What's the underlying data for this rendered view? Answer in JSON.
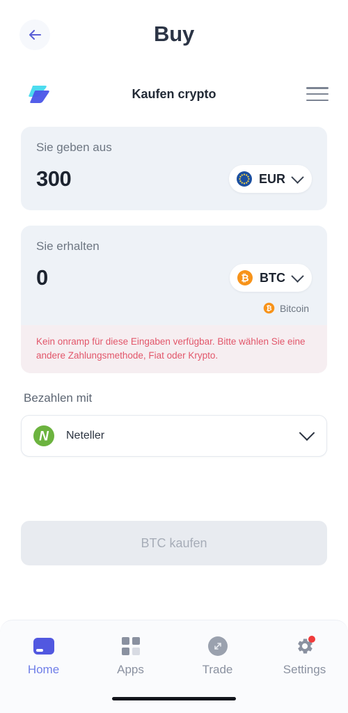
{
  "topbar": {
    "back_icon": "arrow-left-icon",
    "title": "Buy"
  },
  "widget_header": {
    "logo_icon": "brand-layers-logo",
    "title": "Kaufen crypto",
    "menu_icon": "hamburger-menu-icon"
  },
  "spend_card": {
    "label": "Sie geben aus",
    "amount": "300",
    "currency": {
      "code": "EUR",
      "icon": "eur-flag-icon",
      "chevron_icon": "chevron-down-icon"
    }
  },
  "receive_card": {
    "label": "Sie erhalten",
    "amount": "0",
    "currency": {
      "code": "BTC",
      "icon": "bitcoin-icon",
      "chevron_icon": "chevron-down-icon"
    },
    "coin_name": "Bitcoin",
    "coin_name_icon": "bitcoin-icon",
    "error": "Kein onramp für diese Eingaben verfügbar. Bitte wählen Sie eine andere Zahlungsmethode, Fiat oder Krypto."
  },
  "payment": {
    "label": "Bezahlen mit",
    "selected": "Neteller",
    "selected_icon": "neteller-logo-icon",
    "chevron_icon": "chevron-down-icon"
  },
  "cta": {
    "label": "BTC kaufen",
    "disabled": true
  },
  "bottom_nav": {
    "items": [
      {
        "label": "Home",
        "icon": "wallet-icon",
        "active": true
      },
      {
        "label": "Apps",
        "icon": "grid-icon",
        "active": false
      },
      {
        "label": "Trade",
        "icon": "swap-arrows-icon",
        "active": false
      },
      {
        "label": "Settings",
        "icon": "gear-icon",
        "active": false,
        "badge": true
      }
    ]
  },
  "colors": {
    "accent": "#5158e0",
    "error": "#e2566a",
    "card_bg": "#eef2f7",
    "bitcoin": "#f7931a",
    "neteller": "#6cb33f",
    "eu_blue": "#1b4fa0"
  }
}
